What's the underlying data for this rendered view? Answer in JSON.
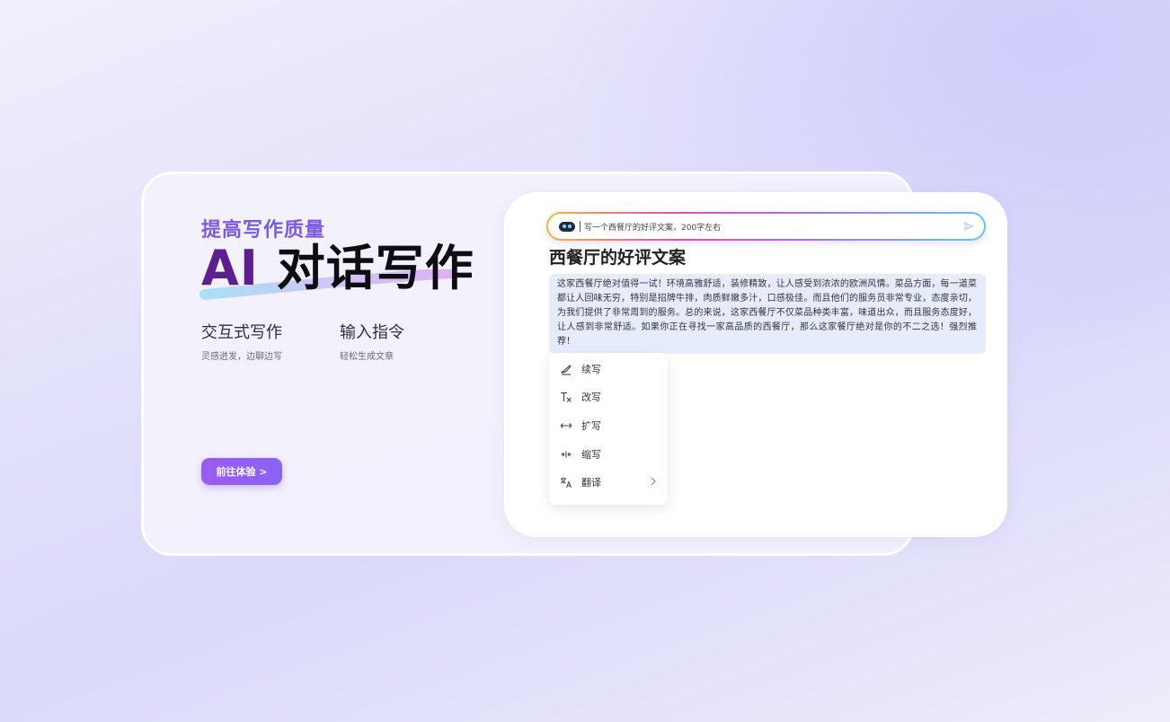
{
  "hero": {
    "eyebrow": "提高写作质量",
    "headline_ai": "AI",
    "headline_rest": "对话写作",
    "features": [
      {
        "title": "交互式写作",
        "subtitle": "灵感迸发，边聊边写"
      },
      {
        "title": "输入指令",
        "subtitle": "轻松生成文章"
      }
    ],
    "cta_label": "前往体验 >"
  },
  "editor": {
    "prompt": "写一个西餐厅的好评文案，200字左右",
    "doc_title": "西餐厅的好评文案",
    "doc_body": "这家西餐厅绝对值得一试！环境高雅舒适，装修精致，让人感受到浓浓的欧洲风情。菜品方面，每一道菜都让人回味无穷，特别是招牌牛排，肉质鲜嫩多汁，口感极佳。而且他们的服务员非常专业，态度亲切，为我们提供了非常周到的服务。总的来说，这家西餐厅不仅菜品种类丰富，味道出众，而且服务态度好，让人感到非常舒适。如果你正在寻找一家高品质的西餐厅，那么这家餐厅绝对是你的不二之选！强烈推荐！",
    "menu": [
      {
        "label": "续写",
        "icon": "pen-icon"
      },
      {
        "label": "改写",
        "icon": "clear-format-icon"
      },
      {
        "label": "扩写",
        "icon": "expand-icon"
      },
      {
        "label": "缩写",
        "icon": "shrink-icon"
      },
      {
        "label": "翻译",
        "icon": "translate-icon",
        "submenu": true
      }
    ]
  },
  "colors": {
    "accent_purple": "#7b5be0",
    "headline_ai": "#5e1f8e",
    "cta_gradient_start": "#9b5cf0",
    "selection_bg": "#e7ecfd"
  }
}
